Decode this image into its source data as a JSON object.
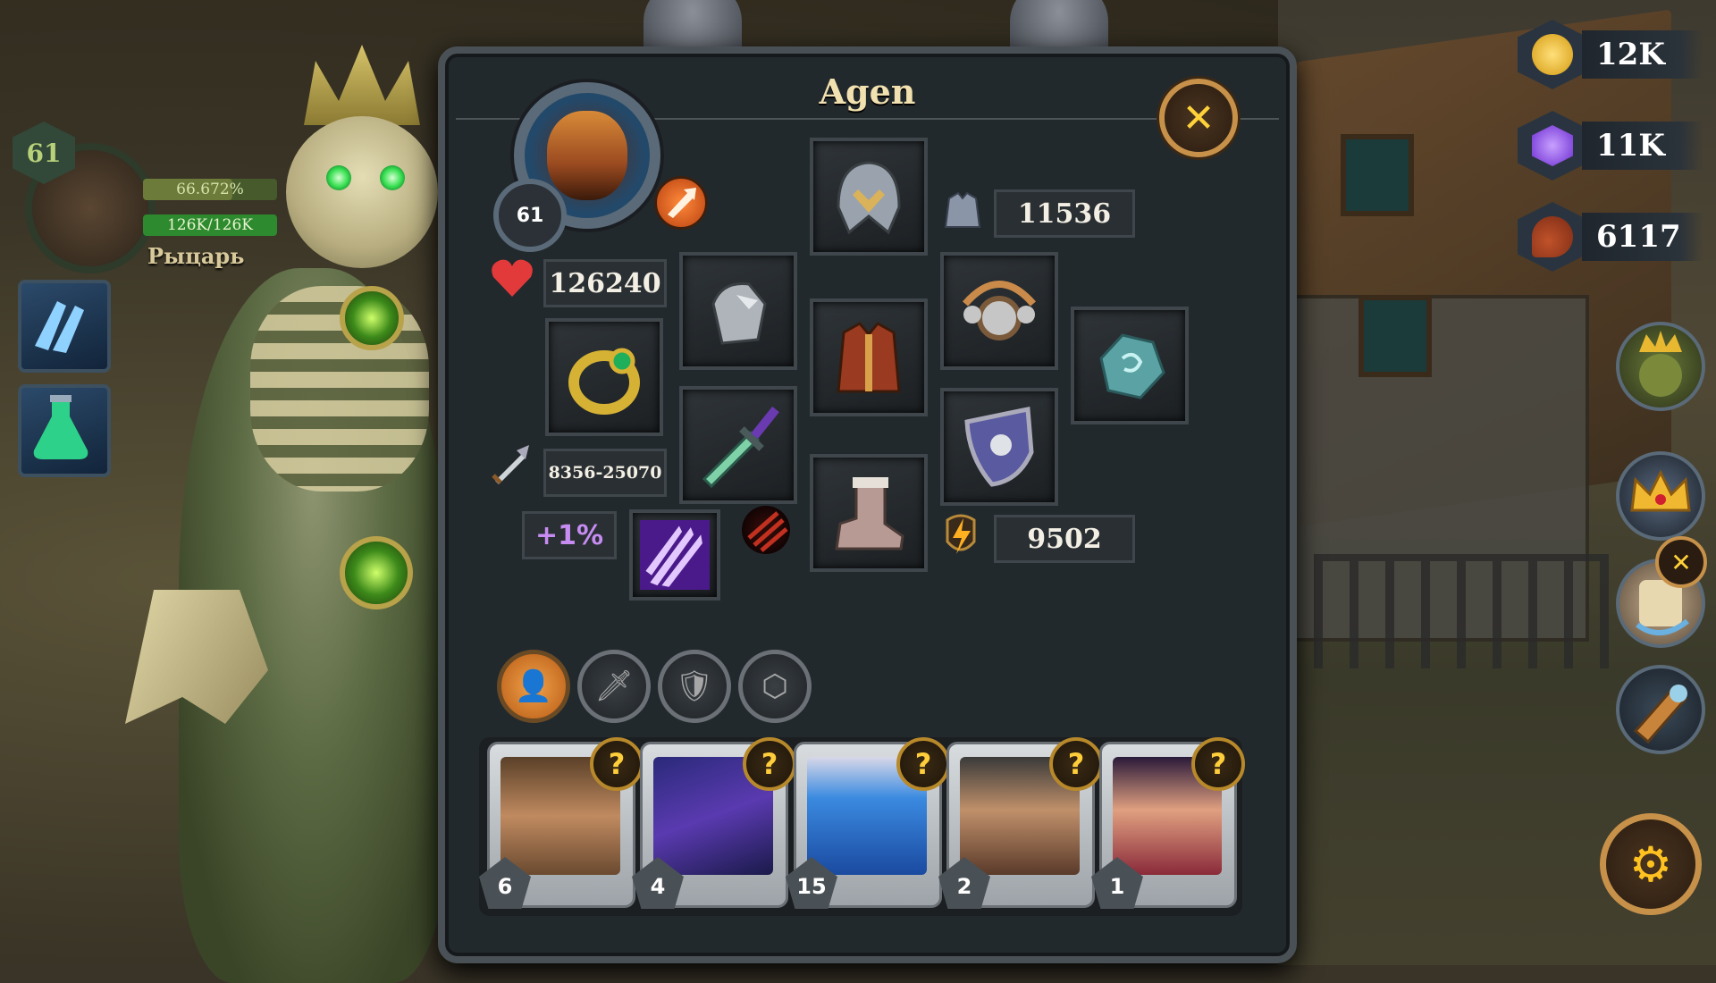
{
  "target": {
    "level": "61",
    "percent": "66.672%",
    "percent_fill": 0.667,
    "hp": "126K/126K",
    "hp_fill": 1.0,
    "name": "Рыцарь"
  },
  "panel": {
    "title": "Agen",
    "close_glyph": "✕"
  },
  "hero": {
    "level": "61",
    "stats": {
      "health": "126240",
      "damage": "8356-25070",
      "armor": "11536",
      "energy": "9502",
      "bonus": "+1%"
    }
  },
  "equipment": [
    {
      "slot": "helmet",
      "icon": "helmet-icon"
    },
    {
      "slot": "gloves",
      "icon": "gauntlet-icon"
    },
    {
      "slot": "ring",
      "icon": "ring-icon"
    },
    {
      "slot": "chest",
      "icon": "chest-armor-icon"
    },
    {
      "slot": "amulet",
      "icon": "amulet-icon"
    },
    {
      "slot": "relic",
      "icon": "rune-stone-icon"
    },
    {
      "slot": "weapon",
      "icon": "sword-icon"
    },
    {
      "slot": "offhand",
      "icon": "shield-icon"
    },
    {
      "slot": "boots",
      "icon": "boot-icon"
    },
    {
      "slot": "skill",
      "icon": "claw-skill-icon"
    }
  ],
  "tabs": [
    {
      "name": "character",
      "glyph": "👤",
      "active": true
    },
    {
      "name": "weapons",
      "glyph": "🗡",
      "active": false
    },
    {
      "name": "defense",
      "glyph": "🛡",
      "active": false
    },
    {
      "name": "runes",
      "glyph": "⬡",
      "active": false
    }
  ],
  "heroes": [
    {
      "count": "6",
      "badge": "?"
    },
    {
      "count": "4",
      "badge": "?"
    },
    {
      "count": "15",
      "badge": "?"
    },
    {
      "count": "2",
      "badge": "?"
    },
    {
      "count": "1",
      "badge": "?"
    }
  ],
  "resources": {
    "gold": "12K",
    "gems": "11K",
    "meat": "6117"
  },
  "colors": {
    "accent_gold": "#c7914a",
    "hp_bar": "#2e8a2e",
    "bonus_text": "#c68cf2"
  },
  "side_close_glyph": "✕",
  "settings_glyph": "⚙"
}
